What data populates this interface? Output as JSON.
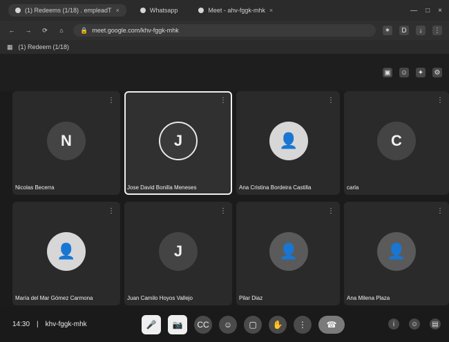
{
  "browser": {
    "tabs": [
      {
        "label": "(1) Redeems (1/18) . empleadT",
        "icon": "spreadsheet-icon",
        "active": true
      },
      {
        "label": "Whatsapp",
        "icon": "whatsapp-icon",
        "active": false
      },
      {
        "label": "Meet - ahv-fggk-mhk",
        "icon": "meet-icon",
        "active": false
      }
    ],
    "url": "meet.google.com/khv-fggk-mhk",
    "bookmark": "(1) Redeem (1/18)"
  },
  "meet": {
    "participants": [
      {
        "name": "Nicolas Becerra",
        "initial": "N",
        "avatar_type": "initial"
      },
      {
        "name": "Jose David Bonilla Meneses",
        "initial": "J",
        "avatar_type": "initial-ring"
      },
      {
        "name": "Ana Cristina Bordeira Castilla",
        "initial": "",
        "avatar_type": "photo"
      },
      {
        "name": "carla",
        "initial": "C",
        "avatar_type": "initial"
      },
      {
        "name": "María del Mar Gómez Carmona",
        "initial": "",
        "avatar_type": "photo"
      },
      {
        "name": "Juan Camilo Hoyos Vallejo",
        "initial": "J",
        "avatar_type": "initial"
      },
      {
        "name": "Pilar Diaz",
        "initial": "",
        "avatar_type": "photo"
      },
      {
        "name": "Ana Milena Plaza",
        "initial": "",
        "avatar_type": "photo"
      }
    ],
    "time": "14:30",
    "meeting_code": "khv-fggk-mhk"
  }
}
